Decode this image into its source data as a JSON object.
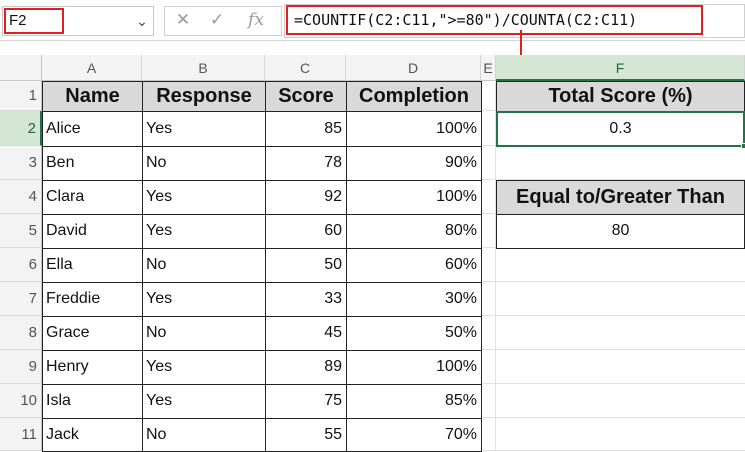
{
  "name_box": {
    "value": "F2",
    "dropdown_icon": "chevron-down-icon"
  },
  "formula_bar": {
    "icons": [
      "close-icon",
      "check-icon",
      "fx-icon"
    ],
    "fx_label": "fx",
    "formula": "=COUNTIF(C2:C11,\">=80\")/COUNTA(C2:C11)"
  },
  "columns": [
    "A",
    "B",
    "C",
    "D",
    "E",
    "F"
  ],
  "rows": [
    "1",
    "2",
    "3",
    "4",
    "5",
    "6",
    "7",
    "8",
    "9",
    "10",
    "11"
  ],
  "table": {
    "headers": [
      "Name",
      "Response",
      "Score",
      "Completion"
    ],
    "rows": [
      [
        "Alice",
        "Yes",
        "85",
        "100%"
      ],
      [
        "Ben",
        "No",
        "78",
        "90%"
      ],
      [
        "Clara",
        "Yes",
        "92",
        "100%"
      ],
      [
        "David",
        "Yes",
        "60",
        "80%"
      ],
      [
        "Ella",
        "No",
        "50",
        "60%"
      ],
      [
        "Freddie",
        "Yes",
        "33",
        "30%"
      ],
      [
        "Grace",
        "No",
        "45",
        "50%"
      ],
      [
        "Henry",
        "Yes",
        "89",
        "100%"
      ],
      [
        "Isla",
        "Yes",
        "75",
        "85%"
      ],
      [
        "Jack",
        "No",
        "55",
        "70%"
      ]
    ]
  },
  "side": {
    "total_label": "Total Score (%)",
    "total_value": "0.3",
    "threshold_label": "Equal to/Greater Than",
    "threshold_value": "80"
  },
  "colors": {
    "highlight": "#e0201f",
    "selection": "#217346",
    "header_fill": "#d9d9d9"
  }
}
